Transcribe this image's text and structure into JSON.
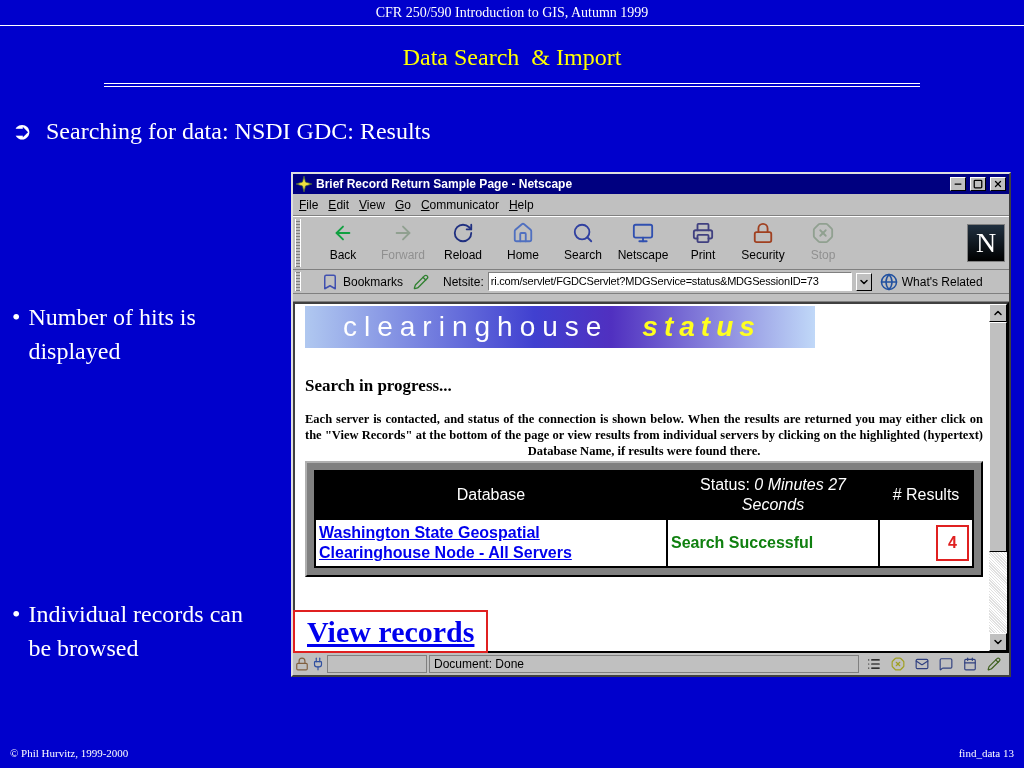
{
  "slide": {
    "header": "CFR 250/590 Introduction to GIS, Autumn 1999",
    "title": "Data Search  & Import",
    "main_bullet": {
      "marker": "➲",
      "text": "Searching for data: NSDI GDC: Results"
    },
    "bullets": [
      {
        "marker": "•",
        "text": "Number of hits is displayed"
      },
      {
        "marker": "•",
        "text": "Individual records can be browsed"
      }
    ],
    "footer_left": "© Phil Hurvitz, 1999-2000",
    "footer_right": "find_data 13"
  },
  "window": {
    "title": "Brief Record Return Sample Page - Netscape",
    "menu": [
      "File",
      "Edit",
      "View",
      "Go",
      "Communicator",
      "Help"
    ],
    "toolbar": [
      {
        "label": "Back",
        "disabled": false
      },
      {
        "label": "Forward",
        "disabled": true
      },
      {
        "label": "Reload",
        "disabled": false
      },
      {
        "label": "Home",
        "disabled": false
      },
      {
        "label": "Search",
        "disabled": false
      },
      {
        "label": "Netscape",
        "disabled": false
      },
      {
        "label": "Print",
        "disabled": false
      },
      {
        "label": "Security",
        "disabled": false
      },
      {
        "label": "Stop",
        "disabled": true
      }
    ],
    "logo": "N",
    "location_bar": {
      "bookmarks": "Bookmarks",
      "netsite_label": "Netsite:",
      "url": "ri.com/servlet/FGDCServlet?MDGService=status&MDGSessionID=73",
      "whats_related": "What's Related"
    },
    "page": {
      "banner": {
        "word_1": "clearinghouse",
        "word_2": "status"
      },
      "heading": "Search in progress...",
      "paragraph": "Each server is contacted, and status of the connection is shown below. When the results are returned you may either click on the \"View Records\" at the bottom of the page or view results from individual servers by clicking on the highlighted (hypertext) Database Name, if results were found there.",
      "table": {
        "columns": [
          "Database",
          "Status: *0 Minutes 27 Seconds*",
          "# Results"
        ],
        "rows": [
          {
            "database": "Washington State Geospatial Clearinghouse Node - All Servers",
            "status": "Search Successful",
            "results": "4"
          }
        ]
      },
      "link": "View records"
    },
    "status_bar": {
      "text": "Document: Done"
    }
  }
}
